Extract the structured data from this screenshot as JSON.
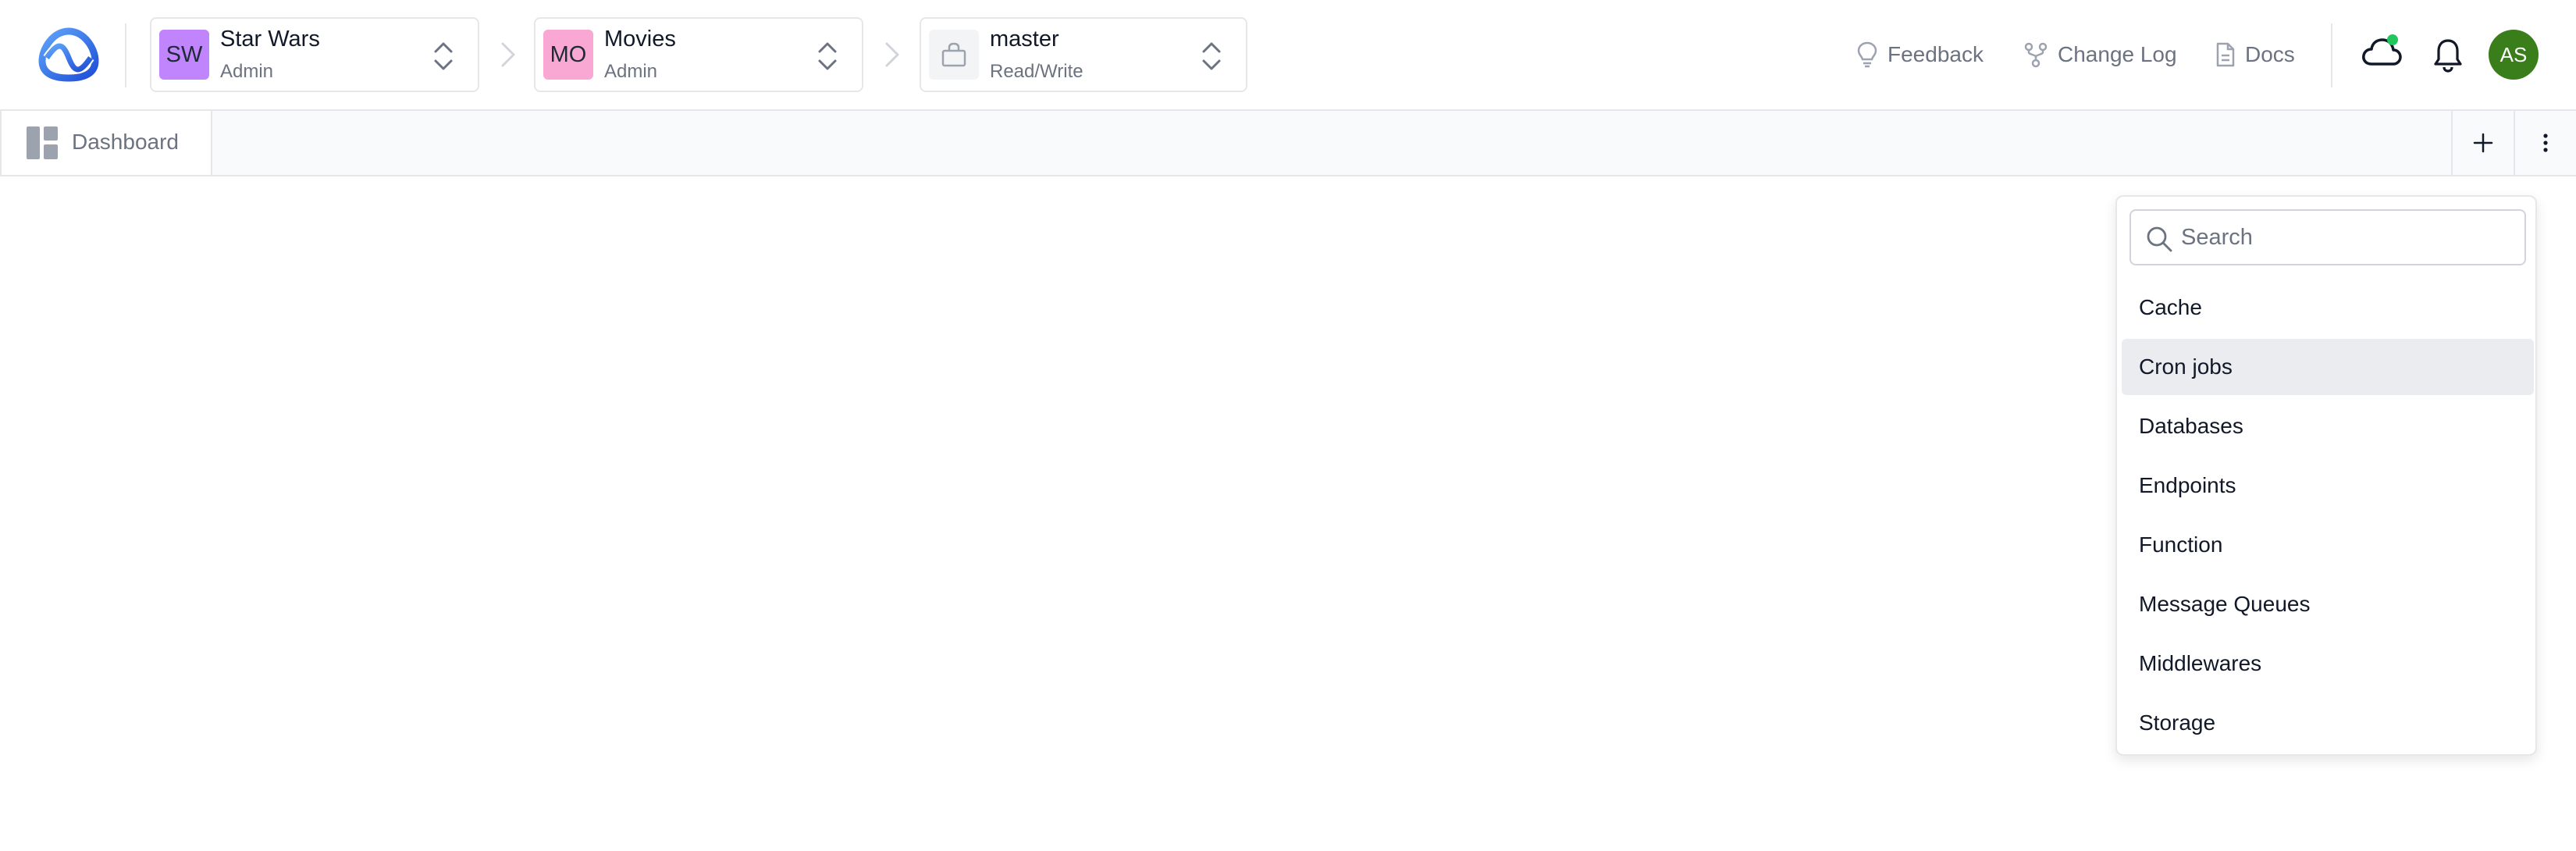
{
  "colors": {
    "brand_blue": "#1d4ed8",
    "sw_badge": "#c084fc",
    "mo_badge": "#f9a8d4",
    "branch_badge": "#f3f4f6",
    "avatar_bg": "#3a7d1b",
    "status_dot": "#22c55e",
    "active_item_bg": "#ebecef"
  },
  "header": {
    "logo_icon": "app-logo",
    "breadcrumbs": [
      {
        "badge": "SW",
        "title": "Star Wars",
        "subtitle": "Admin"
      },
      {
        "badge": "MO",
        "title": "Movies",
        "subtitle": "Admin"
      },
      {
        "badge_icon": "lock-icon",
        "title": "master",
        "subtitle": "Read/Write"
      }
    ],
    "links": [
      {
        "label": "Feedback",
        "icon": "lightbulb-icon"
      },
      {
        "label": "Change Log",
        "icon": "git-fork-icon"
      },
      {
        "label": "Docs",
        "icon": "document-icon"
      }
    ],
    "cloud_icon": "cloud-icon",
    "bell_icon": "bell-icon",
    "avatar_initials": "AS"
  },
  "tabs": {
    "items": [
      {
        "label": "Dashboard",
        "icon": "dashboard-icon"
      }
    ],
    "add_icon": "plus-icon",
    "more_icon": "more-vertical-icon"
  },
  "dropdown": {
    "search_placeholder": "Search",
    "search_value": "",
    "items": [
      "Cache",
      "Cron jobs",
      "Databases",
      "Endpoints",
      "Function",
      "Message Queues",
      "Middlewares",
      "Storage"
    ],
    "active_item": "Cron jobs"
  }
}
